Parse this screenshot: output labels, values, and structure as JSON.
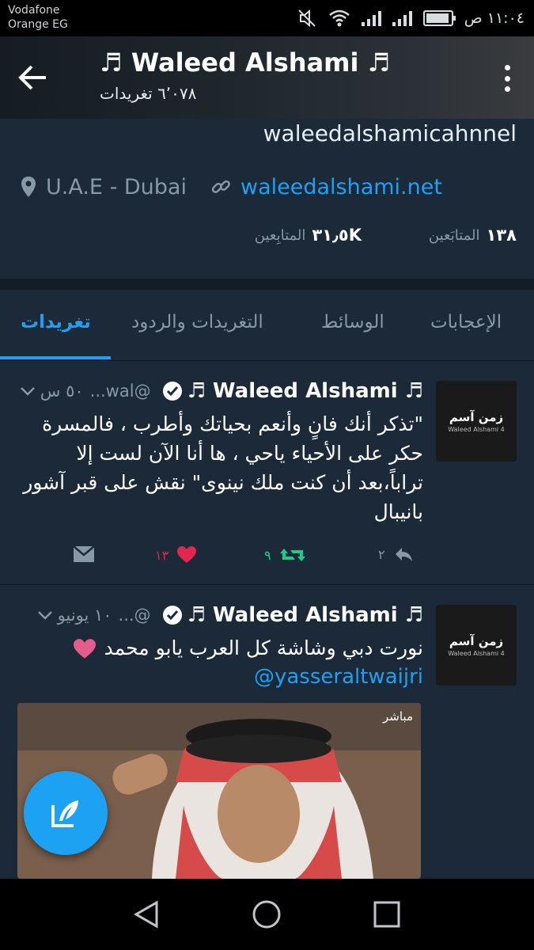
{
  "status_bar": {
    "carrier_line1": "Vodafone",
    "carrier_line2": "Orange EG",
    "time": "١١:٠٤ ص",
    "icons": [
      "mute-icon",
      "wifi-icon",
      "signal-icon",
      "signal-icon",
      "battery-icon"
    ]
  },
  "toolbar": {
    "title": "♬ Waleed Alshami ♬",
    "tweet_count": "٦٬٠٧٨ تغريدات"
  },
  "profile": {
    "bio": "waleedalshamicahnnel",
    "location": "U.A.E - Dubai",
    "website": "waleedalshami.net",
    "following_count": "١٣٨",
    "following_label": "المتابَعين",
    "followers_count": "٣١٫٥K",
    "followers_label": "المتابِعين"
  },
  "tabs": [
    {
      "label": "تغريدات",
      "active": true
    },
    {
      "label": "التغريدات والردود",
      "active": false
    },
    {
      "label": "الوسائط",
      "active": false
    },
    {
      "label": "الإعجابات",
      "active": false
    }
  ],
  "tweets": [
    {
      "name": "♬ Waleed Alshami ♬",
      "handle": "@wal...",
      "time": "٥٠ س",
      "text": "\"تذكر أنك فانٍ وأنعم بحياتك وأطرب ، فالمسرة حكر على الأحياء ياحي ، ها أنا الآن لست إلا تراباً،بعد أن كنت ملك نينوى\" نقش على قبر آشور بانيبال",
      "reply_count": "٢",
      "retweet_count": "٩",
      "like_count": "١٣"
    },
    {
      "name": "♬ Waleed Alshami ♬",
      "handle": "@...",
      "time": "١٠ يونيو",
      "text": "نورت دبي وشاشة كل العرب يابو محمد",
      "mention": "@yasseraltwaijri"
    }
  ],
  "avatar": {
    "logo_main": "زمن آسم",
    "logo_sub": "Waleed Alshami 4"
  },
  "media": {
    "badge": "مباشر"
  },
  "colors": {
    "accent": "#1da1f2",
    "background": "#1c2938",
    "retweet": "#19cf86",
    "like": "#e2264d",
    "muted": "#8899a6"
  }
}
